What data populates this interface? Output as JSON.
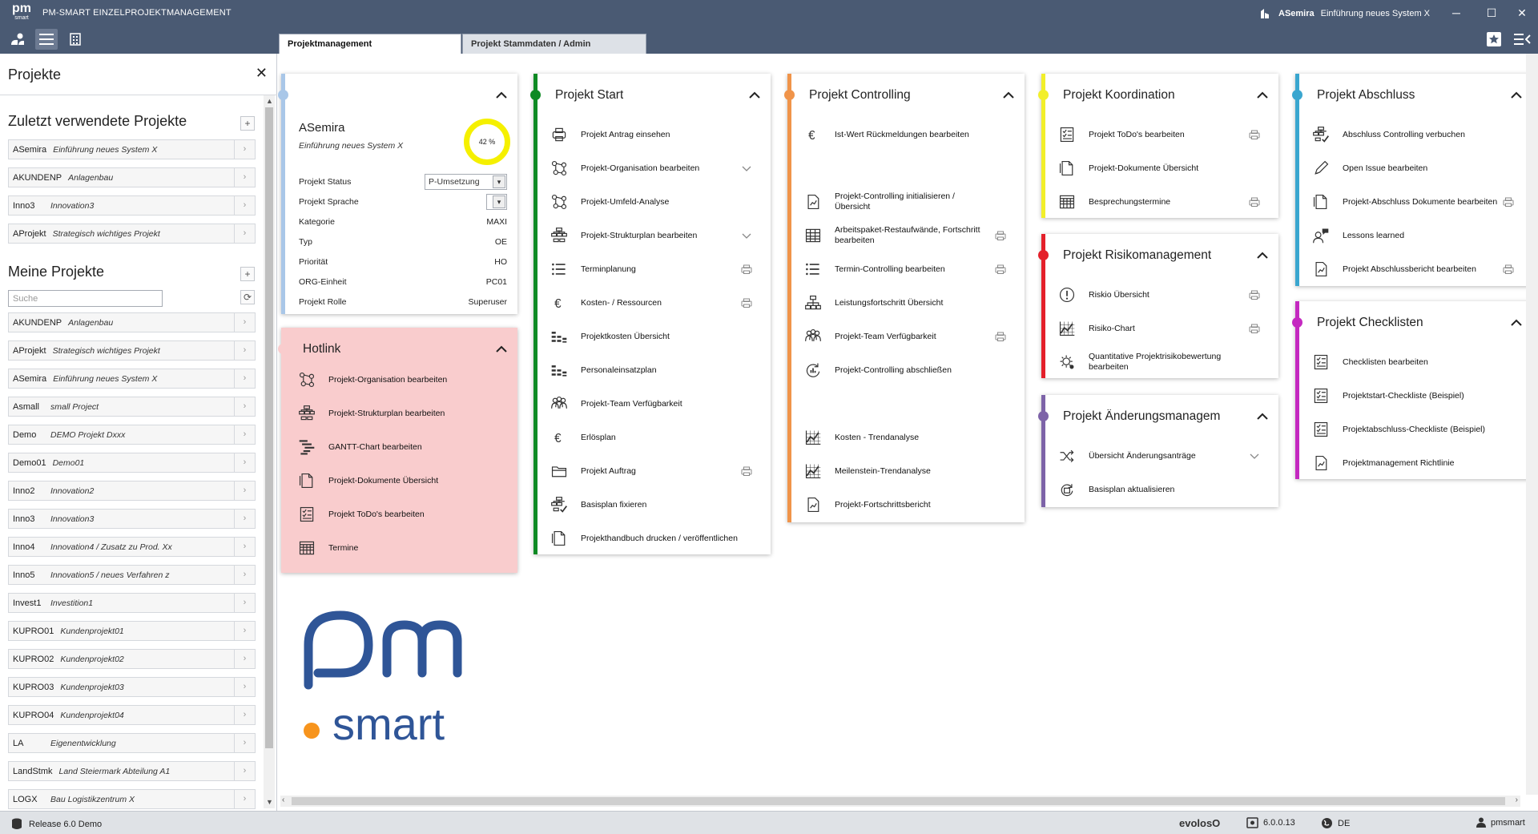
{
  "app": {
    "logo_text": "pm",
    "logo_sub": "smart",
    "title": "PM-SMART EINZELPROJEKTMANAGEMENT",
    "current_project_id": "ASemira",
    "current_project_name": "Einführung neues System X"
  },
  "tabs": [
    {
      "label": "Projektmanagement",
      "active": true
    },
    {
      "label": "Projekt Stammdaten / Admin",
      "active": false
    }
  ],
  "sidebar": {
    "title": "Projekte",
    "recent_title": "Zuletzt verwendete Projekte",
    "recent": [
      {
        "id": "ASemira",
        "name": "Einführung neues System X"
      },
      {
        "id": "AKUNDENP",
        "name": "Anlagenbau"
      },
      {
        "id": "Inno3",
        "name": "Innovation3"
      },
      {
        "id": "AProjekt",
        "name": "Strategisch wichtiges Projekt"
      }
    ],
    "mine_title": "Meine Projekte",
    "search_placeholder": "Suche",
    "mine": [
      {
        "id": "AKUNDENP",
        "name": "Anlagenbau"
      },
      {
        "id": "AProjekt",
        "name": "Strategisch wichtiges Projekt"
      },
      {
        "id": "ASemira",
        "name": "Einführung neues System X"
      },
      {
        "id": "Asmall",
        "name": "small Project"
      },
      {
        "id": "Demo",
        "name": "DEMO Projekt Dxxx"
      },
      {
        "id": "Demo01",
        "name": "Demo01"
      },
      {
        "id": "Inno2",
        "name": "Innovation2"
      },
      {
        "id": "Inno3",
        "name": "Innovation3"
      },
      {
        "id": "Inno4",
        "name": "Innovation4 / Zusatz zu Prod. Xx"
      },
      {
        "id": "Inno5",
        "name": "Innovation5 / neues Verfahren z"
      },
      {
        "id": "Invest1",
        "name": "Investition1"
      },
      {
        "id": "KUPRO01",
        "name": "Kundenprojekt01"
      },
      {
        "id": "KUPRO02",
        "name": "Kundenprojekt02"
      },
      {
        "id": "KUPRO03",
        "name": "Kundenprojekt03"
      },
      {
        "id": "KUPRO04",
        "name": "Kundenprojekt04"
      },
      {
        "id": "LA",
        "name": "Eigenentwicklung"
      },
      {
        "id": "LandStmk",
        "name": "Land Steiermark Abteilung A1"
      },
      {
        "id": "LOGX",
        "name": "Bau Logistikzentrum X"
      }
    ]
  },
  "info_card": {
    "id": "ASemira",
    "name": "Einführung neues System X",
    "progress_label": "42 %",
    "progress": 42,
    "rows": [
      {
        "label": "Projekt Status",
        "value": "P-Umsetzung",
        "type": "select"
      },
      {
        "label": "Projekt Sprache",
        "value": "",
        "type": "select-small"
      },
      {
        "label": "Kategorie",
        "value": "MAXI"
      },
      {
        "label": "Typ",
        "value": "OE"
      },
      {
        "label": "Priorität",
        "value": "HO"
      },
      {
        "label": "ORG-Einheit",
        "value": "PC01"
      },
      {
        "label": "Projekt Rolle",
        "value": "Superuser"
      }
    ]
  },
  "hotlink": {
    "title": "Hotlink",
    "items": [
      {
        "label": "Projekt-Organisation bearbeiten",
        "icon": "org-icon"
      },
      {
        "label": "Projekt-Strukturplan bearbeiten",
        "icon": "structure-icon"
      },
      {
        "label": "GANTT-Chart bearbeiten",
        "icon": "gantt-icon"
      },
      {
        "label": "Projekt-Dokumente Übersicht",
        "icon": "document-icon"
      },
      {
        "label": "Projekt ToDo's bearbeiten",
        "icon": "todo-icon"
      },
      {
        "label": "Termine",
        "icon": "calendar-icon"
      }
    ]
  },
  "start": {
    "title": "Projekt Start",
    "items": [
      {
        "label": "Projekt Antrag einsehen",
        "icon": "print-icon"
      },
      {
        "label": "Projekt-Organisation bearbeiten",
        "icon": "org-icon",
        "act": "chevron"
      },
      {
        "label": "Projekt-Umfeld-Analyse",
        "icon": "org-icon"
      },
      {
        "label": "Projekt-Strukturplan bearbeiten",
        "icon": "structure-icon",
        "act": "chevron"
      },
      {
        "label": "Terminplanung",
        "icon": "list-icon",
        "act": "print"
      },
      {
        "label": "Kosten- / Ressourcen",
        "icon": "euro-icon",
        "act": "print"
      },
      {
        "label": "Projektkosten Übersicht",
        "icon": "bars-icon"
      },
      {
        "label": "Personaleinsatzplan",
        "icon": "bars-icon"
      },
      {
        "label": "Projekt-Team Verfügbarkeit",
        "icon": "team-icon"
      },
      {
        "label": "Erlösplan",
        "icon": "euro-icon"
      },
      {
        "label": "Projekt Auftrag",
        "icon": "folder-icon",
        "act": "print"
      },
      {
        "label": "Basisplan fixieren",
        "icon": "structure-check-icon"
      },
      {
        "label": "Projekthandbuch drucken / veröffentlichen",
        "icon": "document-icon"
      }
    ]
  },
  "controlling": {
    "title": "Projekt Controlling",
    "items": [
      {
        "label": "Ist-Wert Rückmeldungen bearbeiten",
        "icon": "euro-icon",
        "slot": 0
      },
      {
        "label": "Projekt-Controlling initialisieren / Übersicht",
        "icon": "doc-chart-icon",
        "slot": 2
      },
      {
        "label": "Arbeitspaket-Restaufwände, Fortschritt bearbeiten",
        "icon": "grid-icon",
        "slot": 3,
        "act": "print"
      },
      {
        "label": "Termin-Controlling bearbeiten",
        "icon": "list-icon",
        "slot": 4,
        "act": "print"
      },
      {
        "label": "Leistungsfortschritt Übersicht",
        "icon": "hierarchy-icon",
        "slot": 5
      },
      {
        "label": "Projekt-Team Verfügbarkeit",
        "icon": "team-icon",
        "slot": 6,
        "act": "print"
      },
      {
        "label": "Projekt-Controlling abschließen",
        "icon": "cycle-icon",
        "slot": 7
      },
      {
        "label": "Kosten - Trendanalyse",
        "icon": "trend-icon",
        "slot": 9
      },
      {
        "label": "Meilenstein-Trendanalyse",
        "icon": "trend-icon",
        "slot": 10
      },
      {
        "label": "Projekt-Fortschrittsbericht",
        "icon": "doc-chart-icon",
        "slot": 11
      }
    ]
  },
  "koordination": {
    "title": "Projekt Koordination",
    "items": [
      {
        "label": "Projekt ToDo's bearbeiten",
        "icon": "todo-icon",
        "act": "print"
      },
      {
        "label": "Projekt-Dokumente Übersicht",
        "icon": "document-icon"
      },
      {
        "label": "Besprechungstermine",
        "icon": "calendar-icon",
        "act": "print"
      }
    ]
  },
  "risiko": {
    "title": "Projekt Risikomanagement",
    "items": [
      {
        "label": "Riskio Übersicht",
        "icon": "alert-icon",
        "act": "print"
      },
      {
        "label": "Risiko-Chart",
        "icon": "trend-icon",
        "act": "print"
      },
      {
        "label": "Quantitative Projektrisikobewertung bearbeiten",
        "icon": "gear-cycle-icon"
      }
    ]
  },
  "aenderung": {
    "title": "Projekt Änderungsmanagem",
    "items": [
      {
        "label": "Übersicht Änderungsanträge",
        "icon": "shuffle-icon",
        "act": "chevron"
      },
      {
        "label": "Basisplan aktualisieren",
        "icon": "refresh-doc-icon"
      }
    ]
  },
  "abschluss": {
    "title": "Projekt Abschluss",
    "items": [
      {
        "label": "Abschluss Controlling verbuchen",
        "icon": "structure-check-icon"
      },
      {
        "label": "Open Issue bearbeiten",
        "icon": "pencil-icon"
      },
      {
        "label": "Projekt-Abschluss Dokumente bearbeiten",
        "icon": "document-icon",
        "act": "print"
      },
      {
        "label": "Lessons learned",
        "icon": "speech-icon"
      },
      {
        "label": "Projekt Abschlussbericht bearbeiten",
        "icon": "doc-chart-icon",
        "act": "print"
      }
    ]
  },
  "checklisten": {
    "title": "Projekt Checklisten",
    "items": [
      {
        "label": "Checklisten bearbeiten",
        "icon": "todo-icon"
      },
      {
        "label": "Projektstart-Checkliste (Beispiel)",
        "icon": "todo-icon"
      },
      {
        "label": "Projektabschluss-Checkliste (Beispiel)",
        "icon": "todo-icon"
      },
      {
        "label": "Projektmanagement Richtlinie",
        "icon": "doc-chart-icon"
      }
    ]
  },
  "status": {
    "release": "Release 6.0 Demo",
    "brand": "evolosO",
    "version": "6.0.0.13",
    "lang": "DE",
    "user": "pmsmart"
  },
  "colors": {
    "header": "#4a5a73",
    "info": "#a9c7e8",
    "hotlink": "#f9cccd",
    "start": "#0e8a24",
    "controlling": "#f0944a",
    "koordination": "#f2ef2a",
    "risiko": "#e4202a",
    "aenderung": "#7d63a8",
    "abschluss": "#3aa6cf",
    "checklisten": "#c429c0",
    "gauge": "#f5f000"
  }
}
